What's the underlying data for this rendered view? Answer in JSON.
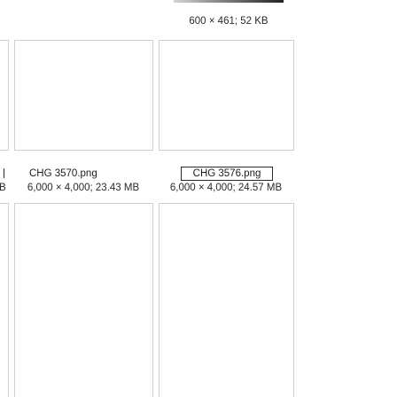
{
  "files": [
    {
      "name": "",
      "meta": "600 × 461; 52 KB",
      "selected": false
    },
    {
      "name": "CHG 3570.png",
      "meta": "6,000 × 4,000; 23.43 MB",
      "selected": false
    },
    {
      "name": "CHG 3576.png",
      "meta": "6,000 × 4,000; 24.57 MB",
      "selected": true
    }
  ],
  "left_partial": {
    "meta_fragment": "B"
  }
}
